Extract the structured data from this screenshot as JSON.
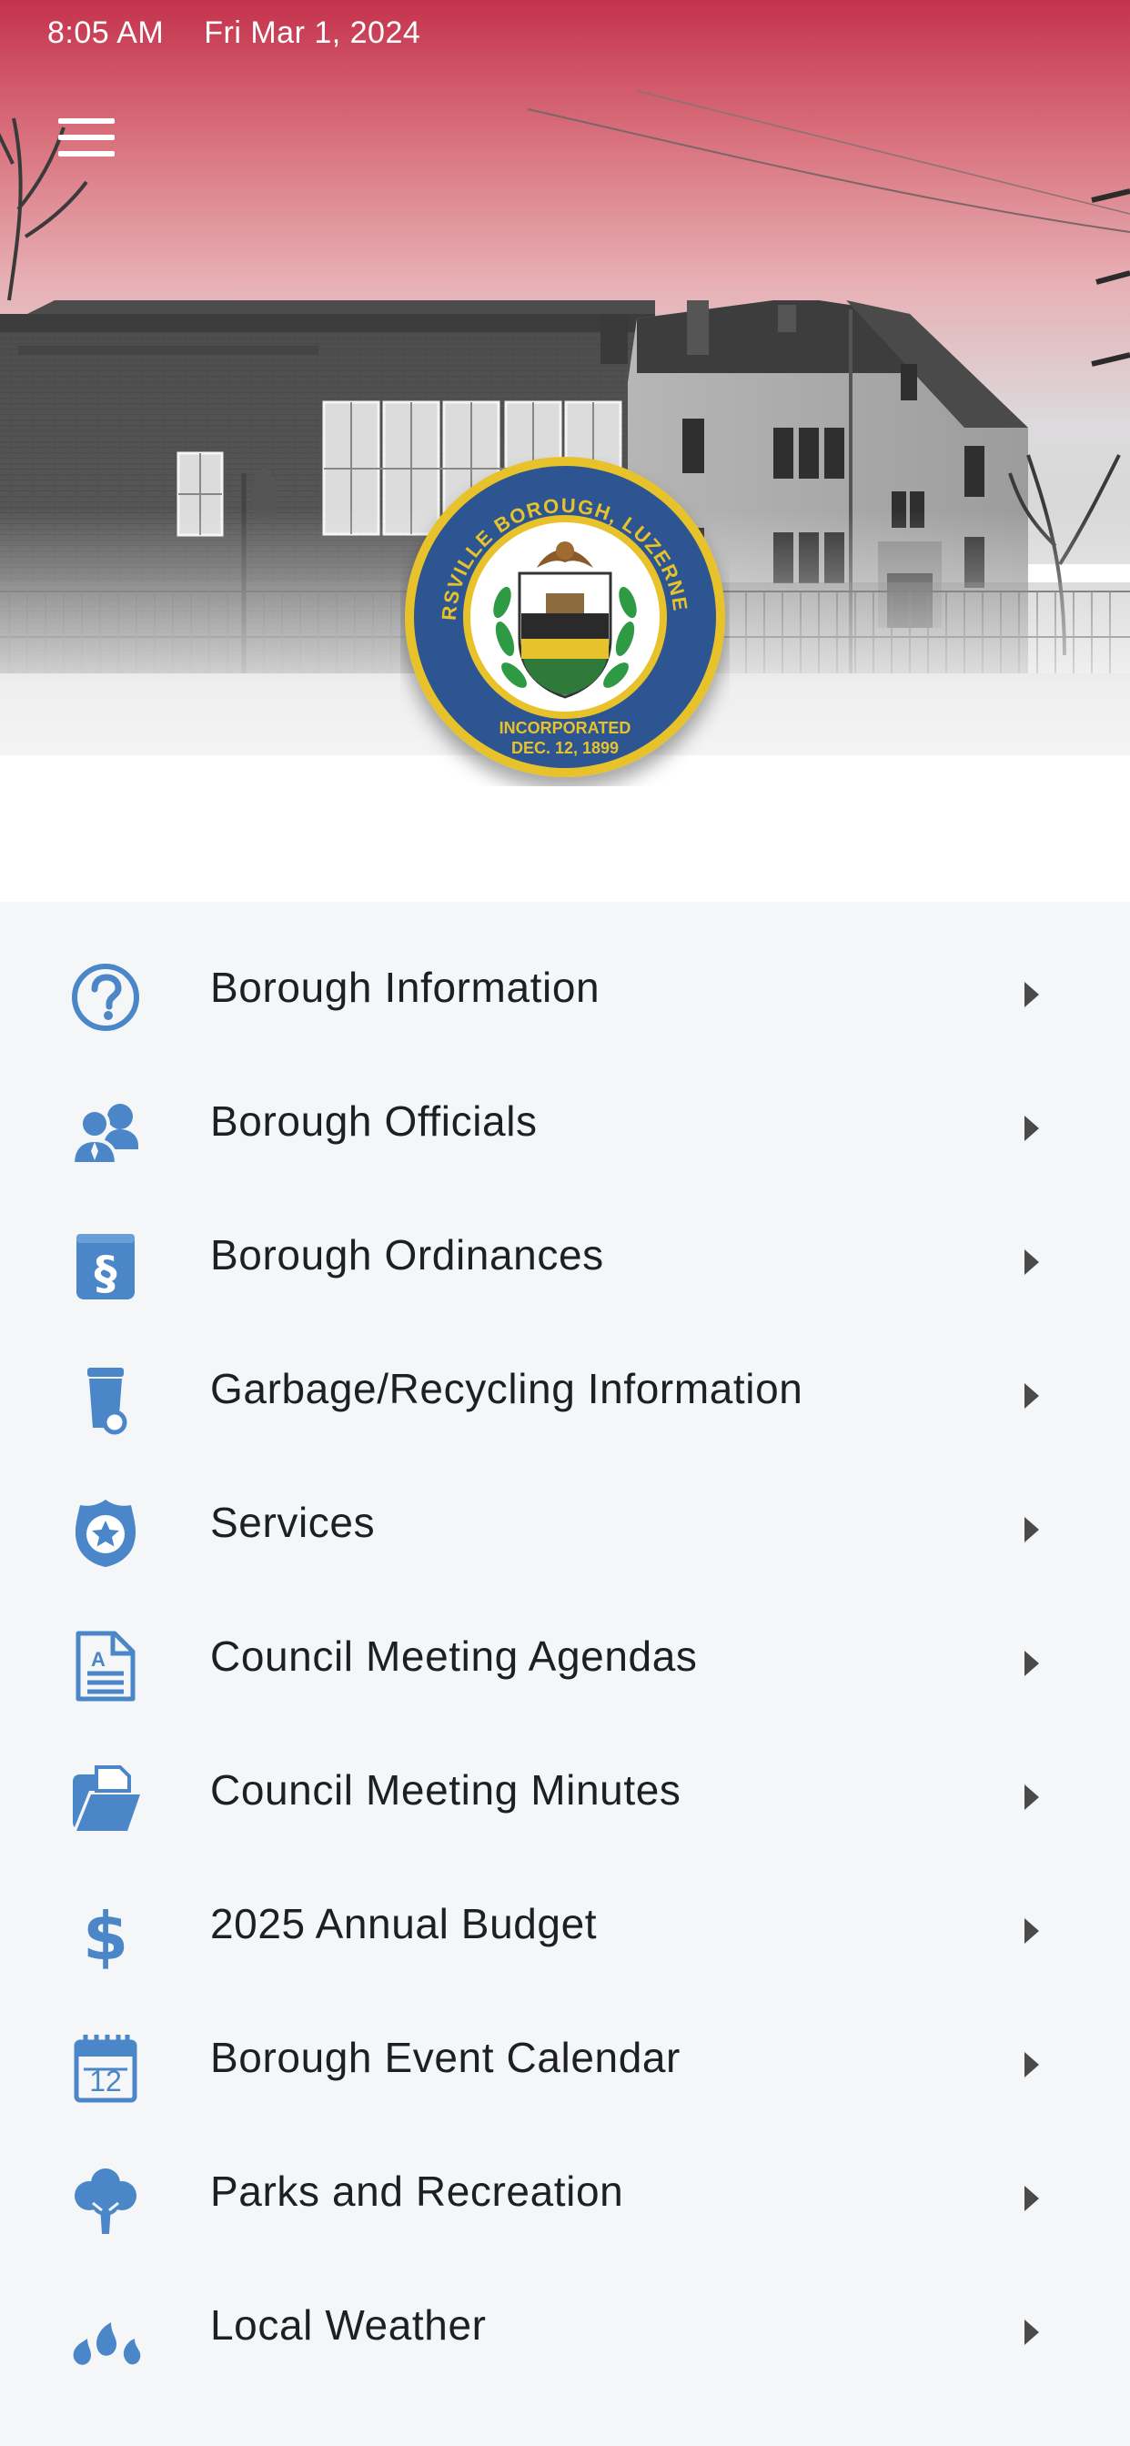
{
  "status_bar": {
    "time": "8:05 AM",
    "date": "Fri Mar 1, 2024"
  },
  "header": {
    "menu_icon": "hamburger-menu-icon",
    "seal": {
      "top_text": "SWOYERSVILLE BOROUGH, LUZERNE CO., PA",
      "bottom_line1": "INCORPORATED",
      "bottom_line2": "DEC. 12, 1899"
    }
  },
  "colors": {
    "icon_blue": "#4a86c8",
    "sky_red": "#c8384f",
    "seal_blue": "#2d5591",
    "seal_gold": "#e8c22a"
  },
  "menu": [
    {
      "label": "Borough Information",
      "icon": "question-circle-icon"
    },
    {
      "label": "Borough Officials",
      "icon": "people-icon"
    },
    {
      "label": "Borough Ordinances",
      "icon": "section-document-icon"
    },
    {
      "label": "Garbage/Recycling Information",
      "icon": "trash-can-icon"
    },
    {
      "label": "Services",
      "icon": "police-badge-icon"
    },
    {
      "label": "Council Meeting Agendas",
      "icon": "agenda-document-icon"
    },
    {
      "label": "Council Meeting Minutes",
      "icon": "open-folder-icon"
    },
    {
      "label": "2025 Annual Budget",
      "icon": "dollar-icon"
    },
    {
      "label": "Borough Event Calendar",
      "icon": "calendar-icon"
    },
    {
      "label": "Parks and Recreation",
      "icon": "tree-icon"
    },
    {
      "label": "Local Weather",
      "icon": "raindrops-icon"
    }
  ]
}
